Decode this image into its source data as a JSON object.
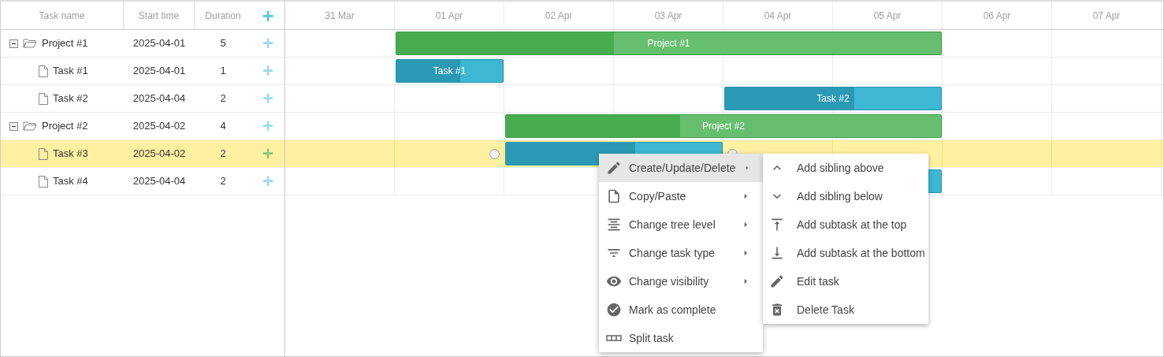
{
  "grid": {
    "columns": [
      {
        "label": "Task name"
      },
      {
        "label": "Start time"
      },
      {
        "label": "Duration"
      }
    ],
    "add_button": "+",
    "rows": [
      {
        "kind": "project",
        "name": "Project #1",
        "start": "2025-04-01",
        "duration": "5",
        "expanded": true,
        "selected": false,
        "bar_label": "Project #1",
        "level": 0.4,
        "children": [
          {
            "kind": "task",
            "name": "Task #1",
            "start": "2025-04-01",
            "duration": "1",
            "selected": false,
            "bar_label": "Task #1",
            "level": 0.6
          },
          {
            "kind": "task",
            "name": "Task #2",
            "start": "2025-04-04",
            "duration": "2",
            "selected": false,
            "bar_label": "Task #2",
            "level": 0.6
          }
        ]
      },
      {
        "kind": "project",
        "name": "Project #2",
        "start": "2025-04-02",
        "duration": "4",
        "expanded": true,
        "selected": false,
        "bar_label": "Project #2",
        "level": 0.4,
        "children": [
          {
            "kind": "task",
            "name": "Task #3",
            "start": "2025-04-02",
            "duration": "2",
            "selected": true,
            "level": 0.6
          },
          {
            "kind": "task",
            "name": "Task #4",
            "start": "2025-04-04",
            "duration": "2",
            "selected": false
          }
        ]
      }
    ]
  },
  "timeline": {
    "columns": [
      "31 Mar",
      "01 Apr",
      "02 Apr",
      "03 Apr",
      "04 Apr",
      "05 Apr",
      "06 Apr",
      "07 Apr"
    ]
  },
  "context_menu": {
    "items": [
      {
        "label": "Create/Update/Delete",
        "has_submenu": true,
        "selected": true
      },
      {
        "label": "Copy/Paste",
        "has_submenu": true,
        "selected": false
      },
      {
        "label": "Change tree level",
        "has_submenu": true,
        "selected": false
      },
      {
        "label": "Change task type",
        "has_submenu": true,
        "selected": false
      },
      {
        "label": "Change visibility",
        "has_submenu": true,
        "selected": false
      },
      {
        "label": "Mark as complete",
        "has_submenu": false,
        "selected": false
      },
      {
        "label": "Split task",
        "has_submenu": false,
        "selected": false
      }
    ],
    "submenu": [
      "Add sibling above",
      "Add sibling below",
      "Add subtask at the top",
      "Add subtask at the bottom",
      "Edit task",
      "Delete Task"
    ]
  }
}
